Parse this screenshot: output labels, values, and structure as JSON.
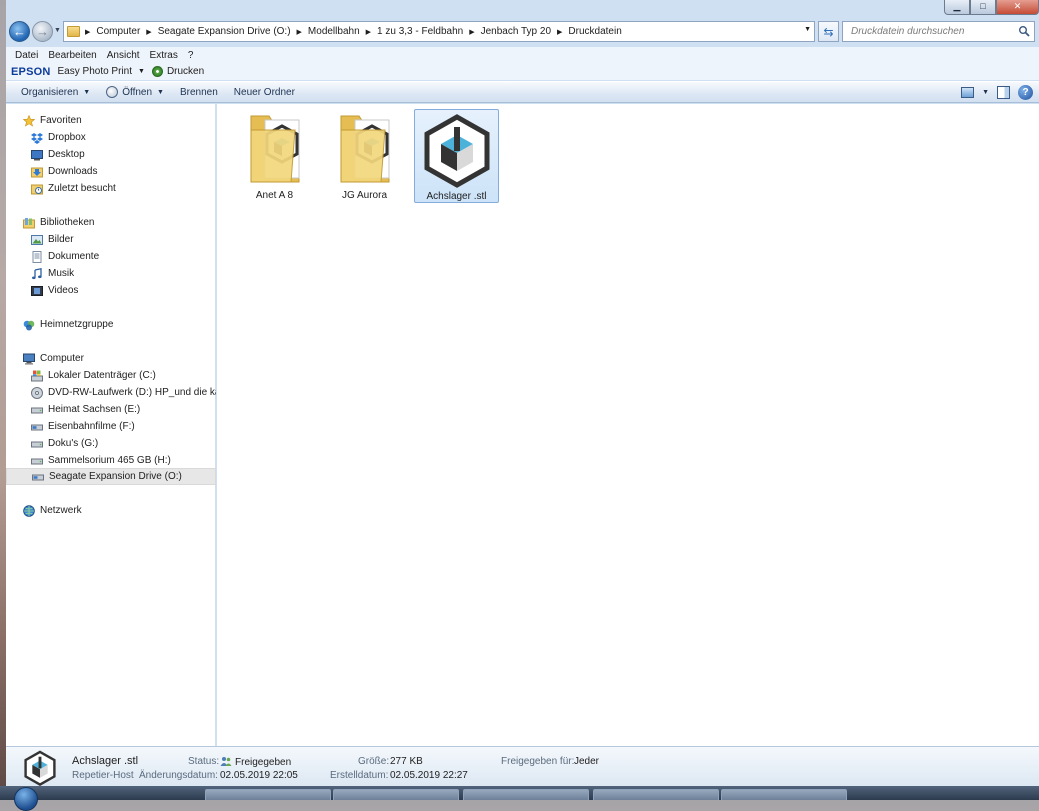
{
  "window": {
    "controls": {
      "minimize": "▁",
      "maximize": "□",
      "close": "✕"
    }
  },
  "address": {
    "crumbs": [
      "Computer",
      "Seagate Expansion Drive (O:)",
      "Modellbahn",
      "1 zu 3,3 - Feldbahn",
      "Jenbach Typ 20",
      "Druckdatein"
    ],
    "search_placeholder": "Druckdatein durchsuchen"
  },
  "menu": [
    "Datei",
    "Bearbeiten",
    "Ansicht",
    "Extras",
    "?"
  ],
  "epson": {
    "logo": "EPSON",
    "easy_photo_print": "Easy Photo Print",
    "print": "Drucken"
  },
  "toolbar": {
    "organize": "Organisieren",
    "open": "Öffnen",
    "burn": "Brennen",
    "new_folder": "Neuer Ordner"
  },
  "nav": {
    "favorites": {
      "label": "Favoriten",
      "items": [
        "Dropbox",
        "Desktop",
        "Downloads",
        "Zuletzt besucht"
      ]
    },
    "libraries": {
      "label": "Bibliotheken",
      "items": [
        "Bilder",
        "Dokumente",
        "Musik",
        "Videos"
      ]
    },
    "homegroup": "Heimnetzgruppe",
    "computer": {
      "label": "Computer",
      "items": [
        "Lokaler Datenträger (C:)",
        "DVD-RW-Laufwerk (D:) HP_und die kam",
        "Heimat Sachsen (E:)",
        "Eisenbahnfilme (F:)",
        "Doku's (G:)",
        "Sammelsorium 465 GB (H:)",
        "Seagate Expansion Drive (O:)"
      ]
    },
    "network": "Netzwerk"
  },
  "files": [
    {
      "name": "Anet A 8",
      "type": "folder"
    },
    {
      "name": "JG Aurora",
      "type": "folder"
    },
    {
      "name": "Achslager .stl",
      "type": "stl",
      "selected": true
    }
  ],
  "details": {
    "name": "Achslager .stl",
    "program": "Repetier-Host",
    "status_label": "Status:",
    "status_value": "Freigegeben",
    "modified_label": "Änderungsdatum:",
    "modified_value": "02.05.2019 22:05",
    "size_label": "Größe:",
    "size_value": "277 KB",
    "created_label": "Erstelldatum:",
    "created_value": "02.05.2019 22:27",
    "shared_label": "Freigegeben für:",
    "shared_value": "Jeder"
  },
  "colors": {
    "accent": "#1f63b2",
    "selection": "#cde3f8",
    "epson": "#0d3b9c"
  }
}
